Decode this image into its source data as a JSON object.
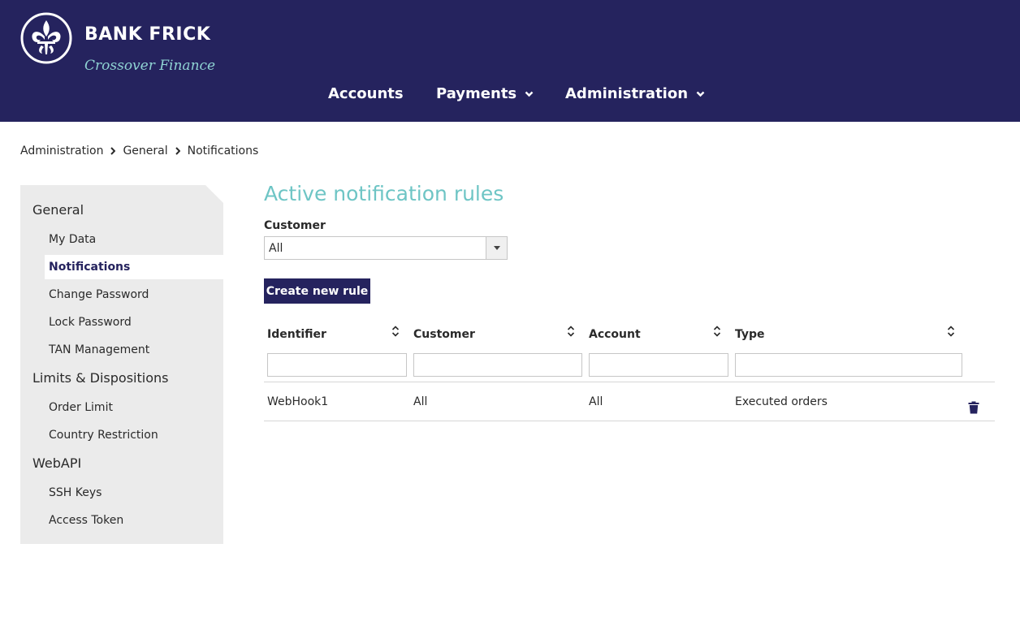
{
  "header": {
    "brand_name": "BANK FRICK",
    "brand_tagline": "Crossover Finance",
    "nav": [
      {
        "label": "Accounts",
        "has_dropdown": false
      },
      {
        "label": "Payments",
        "has_dropdown": true
      },
      {
        "label": "Administration",
        "has_dropdown": true
      }
    ]
  },
  "breadcrumb": [
    "Administration",
    "General",
    "Notifications"
  ],
  "sidebar": {
    "groups": [
      {
        "label": "General",
        "items": [
          "My Data",
          "Notifications",
          "Change Password",
          "Lock Password",
          "TAN Management"
        ]
      },
      {
        "label": "Limits & Dispositions",
        "items": [
          "Order Limit",
          "Country Restriction"
        ]
      },
      {
        "label": "WebAPI",
        "items": [
          "SSH Keys",
          "Access Token"
        ]
      }
    ],
    "active_item": "Notifications"
  },
  "main": {
    "title": "Active notification rules",
    "customer_filter": {
      "label": "Customer",
      "value": "All"
    },
    "create_button": "Create new rule",
    "table": {
      "columns": [
        "Identifier",
        "Customer",
        "Account",
        "Type"
      ],
      "rows": [
        {
          "identifier": "WebHook1",
          "customer": "All",
          "account": "All",
          "type": "Executed orders"
        }
      ]
    }
  },
  "colors": {
    "header_bg": "#25235e",
    "accent_teal": "#6ec5c5",
    "sidebar_bg": "#ebebeb",
    "primary_button": "#25235e"
  },
  "icons": [
    "fleur-de-lis-logo-icon",
    "chevron-down-icon",
    "chevron-right-icon",
    "sort-icon",
    "trash-icon",
    "dropdown-arrow-icon"
  ]
}
